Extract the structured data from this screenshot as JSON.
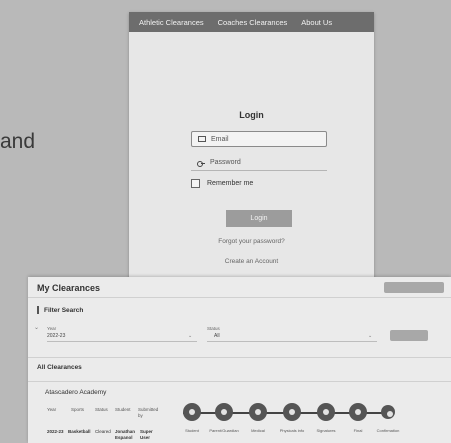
{
  "background": {
    "word": "and"
  },
  "login": {
    "nav": [
      "Athletic Clearances",
      "Coaches Clearances",
      "About Us"
    ],
    "title": "Login",
    "email_placeholder": "Email",
    "password_placeholder": "Password",
    "remember_label": "Remember me",
    "button_label": "Login",
    "forgot_link": "Forgot your password?",
    "create_link": "Create an Account"
  },
  "dashboard": {
    "title": "My Clearances",
    "filter_title": "Filter Search",
    "year_label": "Year",
    "year_value": "2022-23",
    "status_label": "Status",
    "status_value": "All",
    "all_clearances": "All Clearances",
    "academy": "Atascadero Academy",
    "columns": [
      "Year",
      "Sports",
      "Status",
      "Student",
      "Submitted by"
    ],
    "row": [
      "2022-23",
      "Basketball",
      "Cleared",
      "Jonathan Espanol",
      "Super User"
    ],
    "steps": [
      "Student",
      "Parent/Guardian",
      "Medical",
      "Physicals info",
      "Signatures",
      "Final",
      "Confirmation"
    ]
  },
  "colors": {
    "nav_bg": "#6d6d6d",
    "button_bg": "#9c9c9c"
  }
}
